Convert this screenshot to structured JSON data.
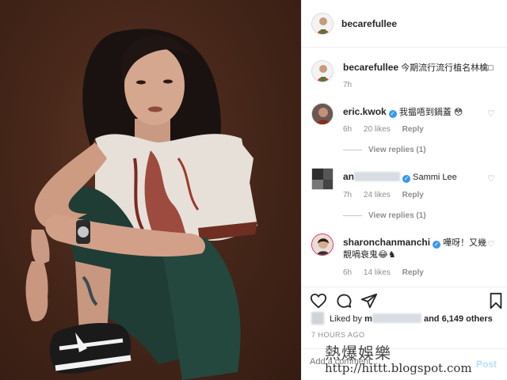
{
  "post": {
    "author": "becarefullee",
    "caption_user": "becarefullee",
    "caption_text": "今期流行流行植名林檎□",
    "caption_age": "7h"
  },
  "comments": [
    {
      "user": "eric.kwok",
      "verified": true,
      "text": "我揾唔到鍋蓋 😳",
      "age": "6h",
      "likes": "20 likes",
      "reply": "Reply",
      "view_replies": "View replies (1)"
    },
    {
      "user": "an",
      "user_blurred": true,
      "verified": true,
      "text": "Sammi Lee",
      "verified_before_text": true,
      "age": "7h",
      "likes": "24 likes",
      "reply": "Reply",
      "view_replies": "View replies (1)"
    },
    {
      "user": "sharonchanmanchi",
      "verified": true,
      "text": "嘩呀！又幾",
      "text2": "靚喎衰鬼😂♞",
      "age": "6h",
      "likes": "14 likes",
      "reply": "Reply"
    }
  ],
  "liked_by": {
    "prefix": "Liked by",
    "name": "m",
    "suffix": "and 6,149 others"
  },
  "timestamp": "7 HOURS AGO",
  "add_comment": {
    "placeholder": "Add a comment...",
    "post_label": "Post"
  },
  "watermark": {
    "line1": "熱爆娛樂",
    "line2": "http://hittt.blogspot.com"
  },
  "icons": [
    "heart-icon",
    "comment-icon",
    "share-icon",
    "bookmark-icon",
    "verified-icon"
  ],
  "colors": {
    "verified": "#3897f0",
    "muted": "#8e8e8e",
    "photo_bg": "#47271a"
  }
}
